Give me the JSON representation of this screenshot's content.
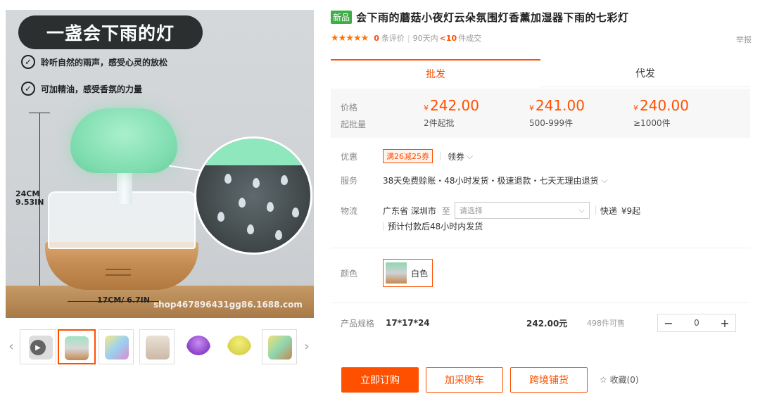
{
  "gallery": {
    "banner_title": "一盏会下雨的灯",
    "features": [
      "聆听自然的雨声，感受心灵的放松",
      "可加精油，感受香氛的力量"
    ],
    "height_dim": [
      "24CM",
      "9.53IN"
    ],
    "width_dim": "17CM/ 6.7IN",
    "watermark": "shop467896431gg86.1688.com",
    "prev": "‹",
    "next": "›"
  },
  "product": {
    "new_tag": "新品",
    "title": "会下雨的蘑菇小夜灯云朵氛围灯香薰加湿器下雨的七彩灯",
    "stars": "★★★★★",
    "review_count": "0",
    "review_label": "条评价",
    "deals_prefix": "90天内",
    "deals_count": "<10",
    "deals_suffix": "件成交",
    "report": "举报"
  },
  "tabs": [
    "批发",
    "代发"
  ],
  "pricing": {
    "price_label": "价格",
    "moq_label": "起批量",
    "currency": "¥",
    "tiers": [
      {
        "price": "242.00",
        "qty": "2件起批"
      },
      {
        "price": "241.00",
        "qty": "500-999件"
      },
      {
        "price": "240.00",
        "qty": "≥1000件"
      }
    ]
  },
  "promo": {
    "label": "优惠",
    "coupon": "满26减25券",
    "get_coupon": "领券"
  },
  "service": {
    "label": "服务",
    "text": "38天免费赊账・48小时发货・极速退款・七天无理由退货"
  },
  "shipping": {
    "label": "物流",
    "from": "广东省 深圳市",
    "to_label": "至",
    "placeholder": "请选择",
    "method": "快递",
    "fee": "¥9起",
    "note": "预计付款后48小时内发货"
  },
  "color": {
    "label": "颜色",
    "option": "白色"
  },
  "spec": {
    "label": "产品规格",
    "value": "17*17*24",
    "price": "242.00元",
    "stock": "498件可售",
    "qty": "0",
    "minus": "−",
    "plus": "+"
  },
  "actions": {
    "buy": "立即订购",
    "cart": "加采购车",
    "cross": "跨境铺货",
    "fav": "☆ 收藏(0)"
  }
}
